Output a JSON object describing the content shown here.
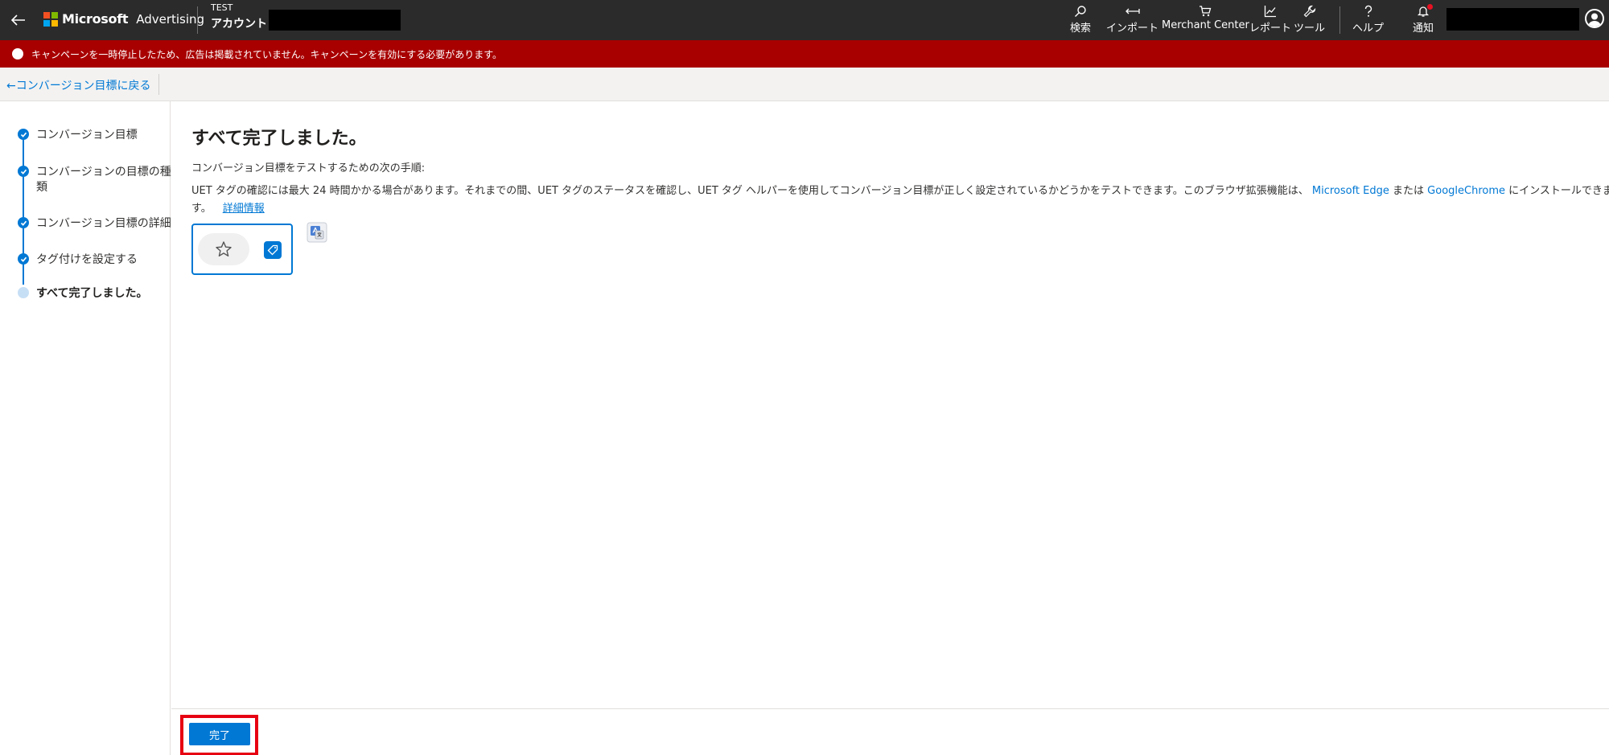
{
  "header": {
    "brand": "Microsoft",
    "product": "Advertising",
    "account_tag": "TEST",
    "account_label": "アカウント",
    "nav": {
      "search": "検索",
      "import": "インポート",
      "merchant": "Merchant Center",
      "report": "レポート",
      "tools": "ツール",
      "help": "ヘルプ",
      "notifications": "通知"
    }
  },
  "alert": {
    "text": "キャンペーンを一時停止したため、広告は掲載されていません。キャンペーンを有効にする必要があります。"
  },
  "breadcrumb": {
    "back_label": "←コンバージョン目標に戻る"
  },
  "stepper": {
    "steps": [
      {
        "label": "コンバージョン目標",
        "status": "done"
      },
      {
        "label": "コンバージョンの目標の種類",
        "status": "done"
      },
      {
        "label": "コンバージョン目標の詳細",
        "status": "done"
      },
      {
        "label": "タグ付けを設定する",
        "status": "done"
      },
      {
        "label": "すべて完了しました。",
        "status": "current"
      }
    ]
  },
  "main": {
    "title": "すべて完了しました。",
    "subtitle": "コンバージョン目標をテストするための次の手順:",
    "paragraph_part1": "UET タグの確認には最大 24 時間かかる場合があります。それまでの間、UET タグのステータスを確認し、UET タグ ヘルパーを使用してコンバージョン目標が正しく設定されているかどうかをテストできます。このブラウザ拡張機能は、",
    "link_edge": "Microsoft Edge",
    "paragraph_or": "または",
    "link_chrome": "GoogleChrome",
    "paragraph_part2": "にインストールできます",
    "paragraph_end": "す。",
    "learn_more": "詳細情報"
  },
  "footer": {
    "done_label": "完了"
  },
  "colors": {
    "header_bg": "#2b2b2b",
    "alert_bg": "#a80000",
    "accent": "#0078d4",
    "highlight": "#e60012"
  }
}
